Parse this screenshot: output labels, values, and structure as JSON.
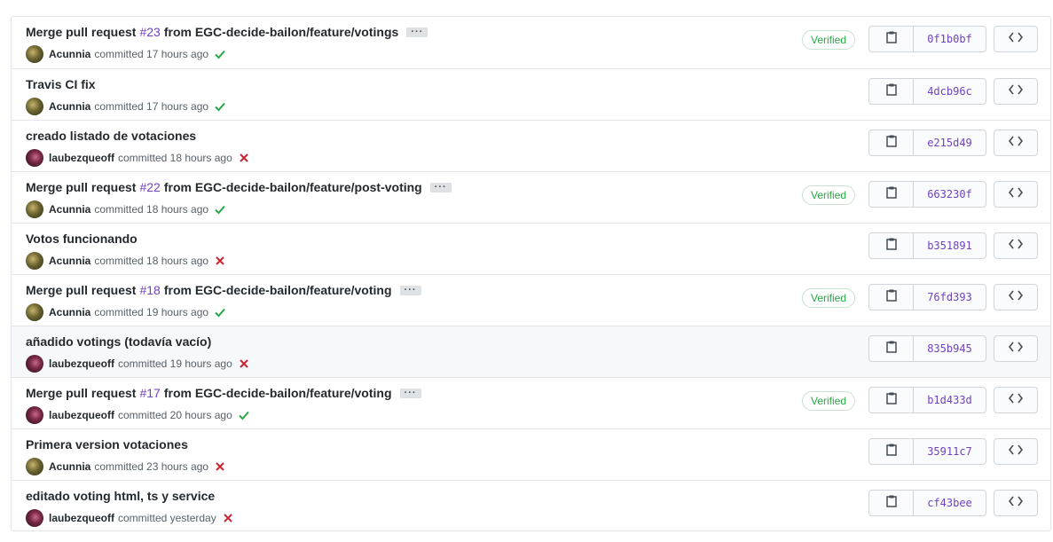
{
  "commits": [
    {
      "title_prefix": "Merge pull request",
      "pr": "#23",
      "title_suffix": "from EGC-decide-bailon/feature/votings",
      "has_ellipsis": true,
      "author": "Acunnia",
      "avatar": "acunnia",
      "committed": "committed 17 hours ago",
      "status": "success",
      "verified": "Verified",
      "sha": "0f1b0bf"
    },
    {
      "title_prefix": "Travis CI fix",
      "pr": "",
      "title_suffix": "",
      "has_ellipsis": false,
      "author": "Acunnia",
      "avatar": "acunnia",
      "committed": "committed 17 hours ago",
      "status": "success",
      "verified": "",
      "sha": "4dcb96c"
    },
    {
      "title_prefix": "creado listado de votaciones",
      "pr": "",
      "title_suffix": "",
      "has_ellipsis": false,
      "author": "laubezqueoff",
      "avatar": "laube",
      "committed": "committed 18 hours ago",
      "status": "failure",
      "verified": "",
      "sha": "e215d49"
    },
    {
      "title_prefix": "Merge pull request",
      "pr": "#22",
      "title_suffix": "from EGC-decide-bailon/feature/post-voting",
      "has_ellipsis": true,
      "author": "Acunnia",
      "avatar": "acunnia",
      "committed": "committed 18 hours ago",
      "status": "success",
      "verified": "Verified",
      "sha": "663230f"
    },
    {
      "title_prefix": "Votos funcionando",
      "pr": "",
      "title_suffix": "",
      "has_ellipsis": false,
      "author": "Acunnia",
      "avatar": "acunnia",
      "committed": "committed 18 hours ago",
      "status": "failure",
      "verified": "",
      "sha": "b351891"
    },
    {
      "title_prefix": "Merge pull request",
      "pr": "#18",
      "title_suffix": "from EGC-decide-bailon/feature/voting",
      "has_ellipsis": true,
      "author": "Acunnia",
      "avatar": "acunnia",
      "committed": "committed 19 hours ago",
      "status": "success",
      "verified": "Verified",
      "sha": "76fd393"
    },
    {
      "title_prefix": "añadido votings (todavía vacío)",
      "pr": "",
      "title_suffix": "",
      "has_ellipsis": false,
      "author": "laubezqueoff",
      "avatar": "laube",
      "committed": "committed 19 hours ago",
      "status": "failure",
      "verified": "",
      "sha": "835b945"
    },
    {
      "title_prefix": "Merge pull request",
      "pr": "#17",
      "title_suffix": "from EGC-decide-bailon/feature/voting",
      "has_ellipsis": true,
      "author": "laubezqueoff",
      "avatar": "laube",
      "committed": "committed 20 hours ago",
      "status": "success",
      "verified": "Verified",
      "sha": "b1d433d"
    },
    {
      "title_prefix": "Primera version votaciones",
      "pr": "",
      "title_suffix": "",
      "has_ellipsis": false,
      "author": "Acunnia",
      "avatar": "acunnia",
      "committed": "committed 23 hours ago",
      "status": "failure",
      "verified": "",
      "sha": "35911c7"
    },
    {
      "title_prefix": "editado voting html, ts y service",
      "pr": "",
      "title_suffix": "",
      "has_ellipsis": false,
      "author": "laubezqueoff",
      "avatar": "laube",
      "committed": "committed yesterday",
      "status": "failure",
      "verified": "",
      "sha": "cf43bee"
    }
  ],
  "ellipsis_label": "···",
  "highlighted_row": 6,
  "icons": {
    "copy": "clipboard-icon",
    "browse": "code-brackets-icon",
    "success": "check-icon",
    "failure": "x-icon"
  },
  "colors": {
    "success": "#28a745",
    "failure": "#cb2431",
    "sha": "#6f42c1",
    "pr_link": "#6f42c1"
  }
}
